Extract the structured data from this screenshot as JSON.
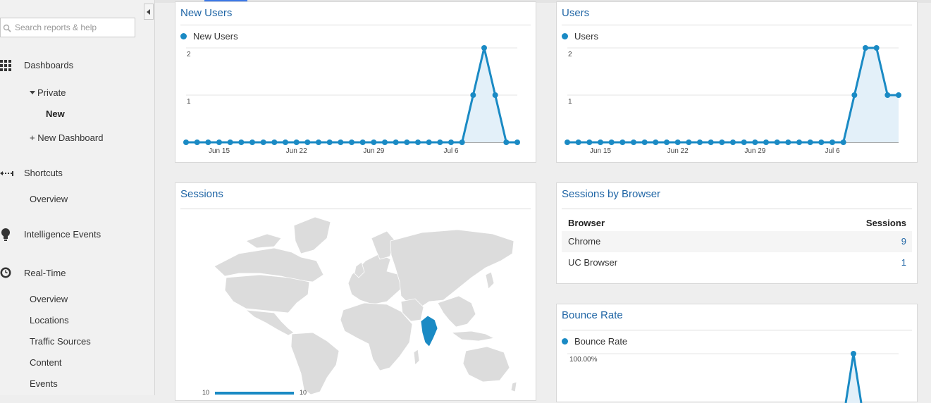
{
  "sidebar": {
    "search_placeholder": "Search reports & help",
    "items": {
      "dashboards": "Dashboards",
      "private": "Private",
      "new": "New",
      "new_dashboard": "+ New Dashboard",
      "shortcuts": "Shortcuts",
      "shortcuts_overview": "Overview",
      "intelligence": "Intelligence Events",
      "realtime": "Real-Time",
      "rt_overview": "Overview",
      "rt_locations": "Locations",
      "rt_traffic": "Traffic Sources",
      "rt_content": "Content",
      "rt_events": "Events"
    },
    "icons": [
      "search-icon",
      "collapse-icon",
      "dashboard-grid-icon",
      "caret-down-icon",
      "shortcut-icon",
      "lightbulb-icon",
      "clock-icon"
    ]
  },
  "panels": {
    "new_users": {
      "title": "New Users",
      "legend": "New Users"
    },
    "users": {
      "title": "Users",
      "legend": "Users"
    },
    "sessions": {
      "title": "Sessions",
      "bar_left_label": "10",
      "bar_right_label": "10"
    },
    "browser": {
      "title": "Sessions by Browser",
      "col_browser": "Browser",
      "col_sessions": "Sessions",
      "rows": [
        {
          "browser": "Chrome",
          "sessions": "9"
        },
        {
          "browser": "UC Browser",
          "sessions": "1"
        }
      ]
    },
    "bounce": {
      "title": "Bounce Rate",
      "legend": "Bounce Rate",
      "y_top": "100.00%"
    }
  },
  "accent_color": "#1a8ac4",
  "chart_data": [
    {
      "type": "area",
      "title": "New Users",
      "x_tick_labels": [
        "Jun 15",
        "Jun 22",
        "Jun 29",
        "Jul 6"
      ],
      "y_tick_labels": [
        "1",
        "2"
      ],
      "ylim": [
        0,
        2
      ],
      "series": [
        {
          "name": "New Users",
          "values": [
            0,
            0,
            0,
            0,
            0,
            0,
            0,
            0,
            0,
            0,
            0,
            0,
            0,
            0,
            0,
            0,
            0,
            0,
            0,
            0,
            0,
            0,
            0,
            0,
            0,
            0,
            1,
            2,
            1,
            0,
            0
          ]
        }
      ]
    },
    {
      "type": "area",
      "title": "Users",
      "x_tick_labels": [
        "Jun 15",
        "Jun 22",
        "Jun 29",
        "Jul 6"
      ],
      "y_tick_labels": [
        "1",
        "2"
      ],
      "ylim": [
        0,
        2
      ],
      "series": [
        {
          "name": "Users",
          "values": [
            0,
            0,
            0,
            0,
            0,
            0,
            0,
            0,
            0,
            0,
            0,
            0,
            0,
            0,
            0,
            0,
            0,
            0,
            0,
            0,
            0,
            0,
            0,
            0,
            0,
            0,
            1,
            2,
            2,
            1,
            1
          ]
        }
      ]
    },
    {
      "type": "line",
      "title": "Bounce Rate",
      "y_tick_labels": [
        "100.00%"
      ],
      "series": [
        {
          "name": "Bounce Rate",
          "values": [
            1.0
          ]
        }
      ]
    }
  ]
}
